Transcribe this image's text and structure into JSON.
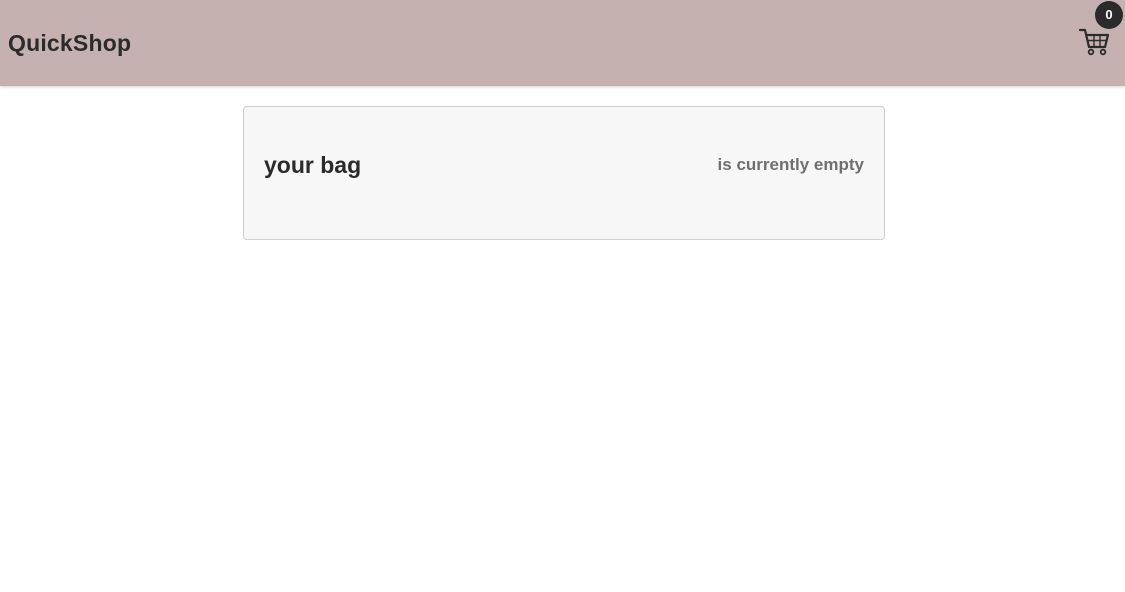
{
  "header": {
    "brand": "QuickShop",
    "cart_icon": "shopping-cart-icon",
    "cart_count": "0"
  },
  "bag": {
    "title": "your bag",
    "status": "is currently empty"
  },
  "colors": {
    "header_bg": "#c4b1b0",
    "text_dark": "#2b2b2b",
    "text_muted": "#6f6f6f",
    "card_bg": "#f7f7f7",
    "badge_bg": "#2b2b2b"
  }
}
